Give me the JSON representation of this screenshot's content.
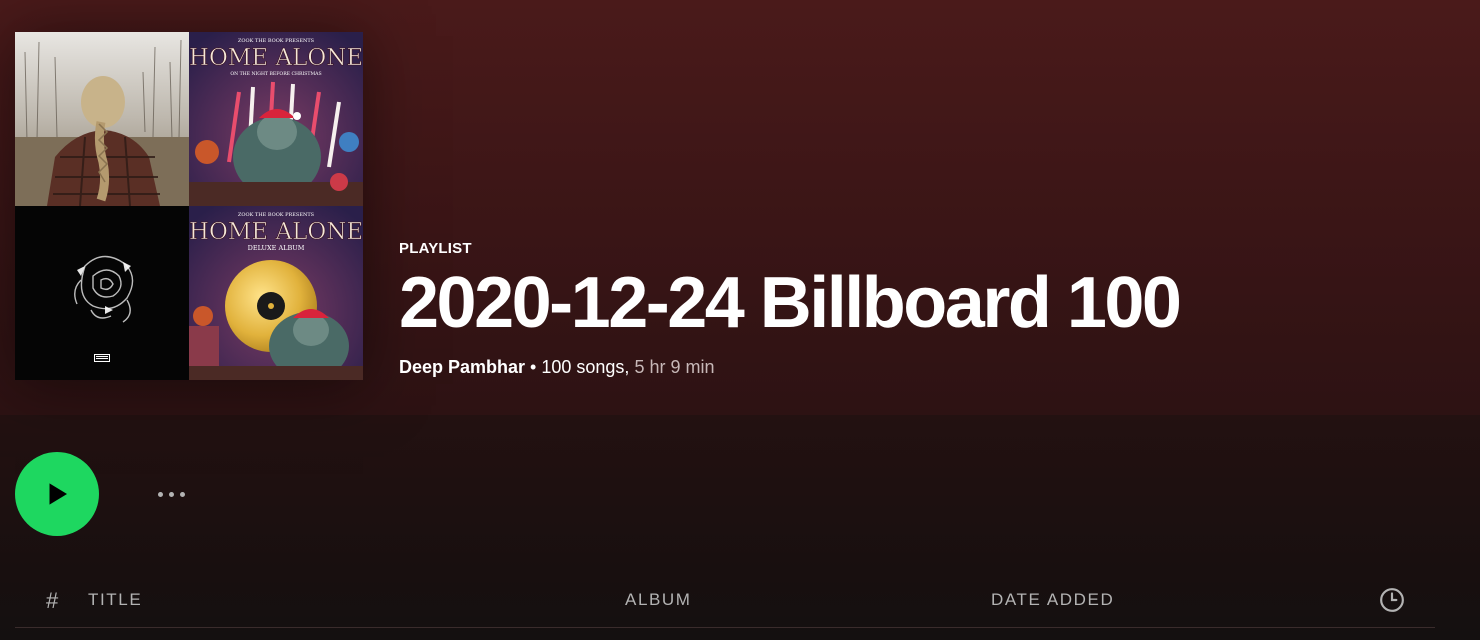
{
  "playlist": {
    "type_label": "PLAYLIST",
    "title": "2020-12-24 Billboard 100",
    "owner": "Deep Pambhar",
    "separator": " • ",
    "song_count": "100 songs,",
    "duration": "5 hr 9 min"
  },
  "covers": [
    {
      "name": "cover-woman-braid"
    },
    {
      "name": "cover-home-alone",
      "title": "HOME ALONE",
      "subtitle": "ON THE NIGHT BEFORE CHRISTMAS",
      "top_text": "ZOOK THE BOOK PRESENTS"
    },
    {
      "name": "cover-black-rose",
      "badge": "PARENTAL ADVISORY"
    },
    {
      "name": "cover-home-alone-deluxe",
      "title": "HOME ALONE",
      "subtitle": "DELUXE ALBUM",
      "top_text": "ZOOK THE BOOK PRESENTS"
    }
  ],
  "action_bar": {
    "play_icon": "play-icon",
    "more_icon": "more-options-icon",
    "accent_color": "#1ed760"
  },
  "columns": {
    "number": "#",
    "title": "TITLE",
    "album": "ALBUM",
    "date_added": "DATE ADDED",
    "duration_icon": "clock-icon"
  }
}
